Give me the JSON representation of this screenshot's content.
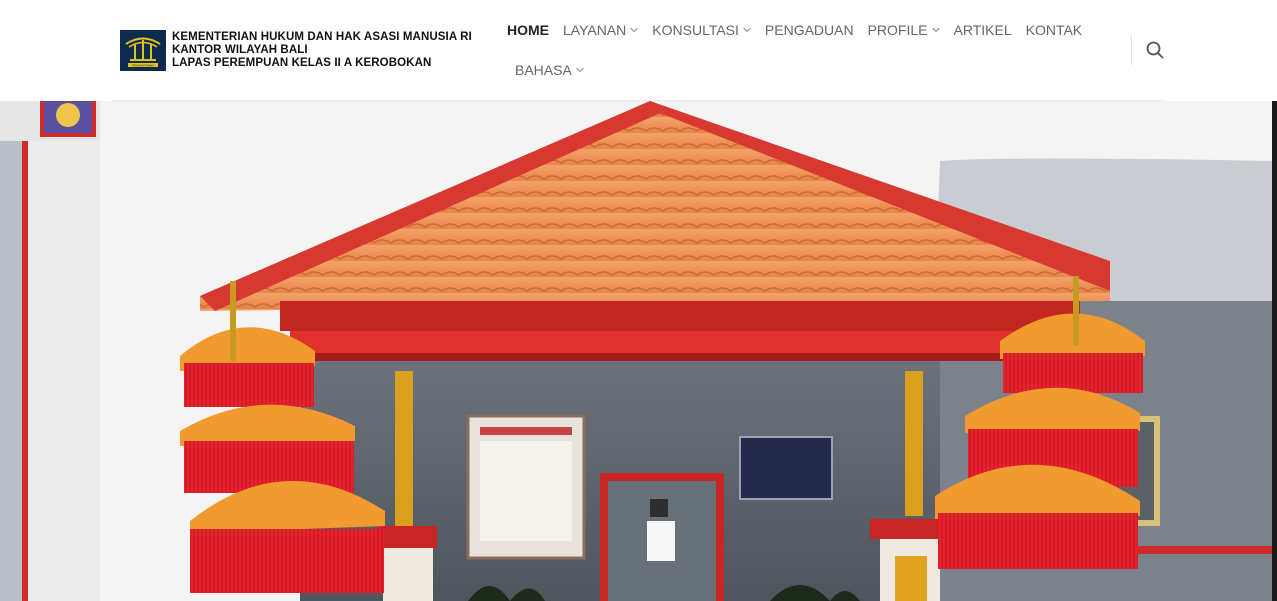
{
  "header": {
    "logo_alt": "pengayoman-logo",
    "org_lines": [
      "KEMENTERIAN HUKUM DAN HAK ASASI MANUSIA RI",
      "KANTOR WILAYAH BALI",
      "LAPAS PEREMPUAN KELAS II A KEROBOKAN"
    ],
    "logo_caption": "PENGAYOMAN"
  },
  "nav": {
    "items": [
      {
        "label": "HOME",
        "active": true,
        "dropdown": false
      },
      {
        "label": "LAYANAN",
        "active": false,
        "dropdown": true
      },
      {
        "label": "KONSULTASI",
        "active": false,
        "dropdown": true
      },
      {
        "label": "PENGADUAN",
        "active": false,
        "dropdown": false
      },
      {
        "label": "PROFILE",
        "active": false,
        "dropdown": true
      },
      {
        "label": "ARTIKEL",
        "active": false,
        "dropdown": false
      },
      {
        "label": "KONTAK",
        "active": false,
        "dropdown": false
      }
    ],
    "second_row": [
      {
        "label": "BAHASA",
        "active": false,
        "dropdown": true
      }
    ]
  },
  "icons": {
    "search": "search-icon",
    "chevron": "chevron-down-icon"
  },
  "colors": {
    "nav_text": "#666666",
    "nav_active": "#222222",
    "logo_bg": "#0d2b4e",
    "logo_gold": "#e3c21c"
  },
  "hero": {
    "image": "balinese-gate-photo"
  }
}
